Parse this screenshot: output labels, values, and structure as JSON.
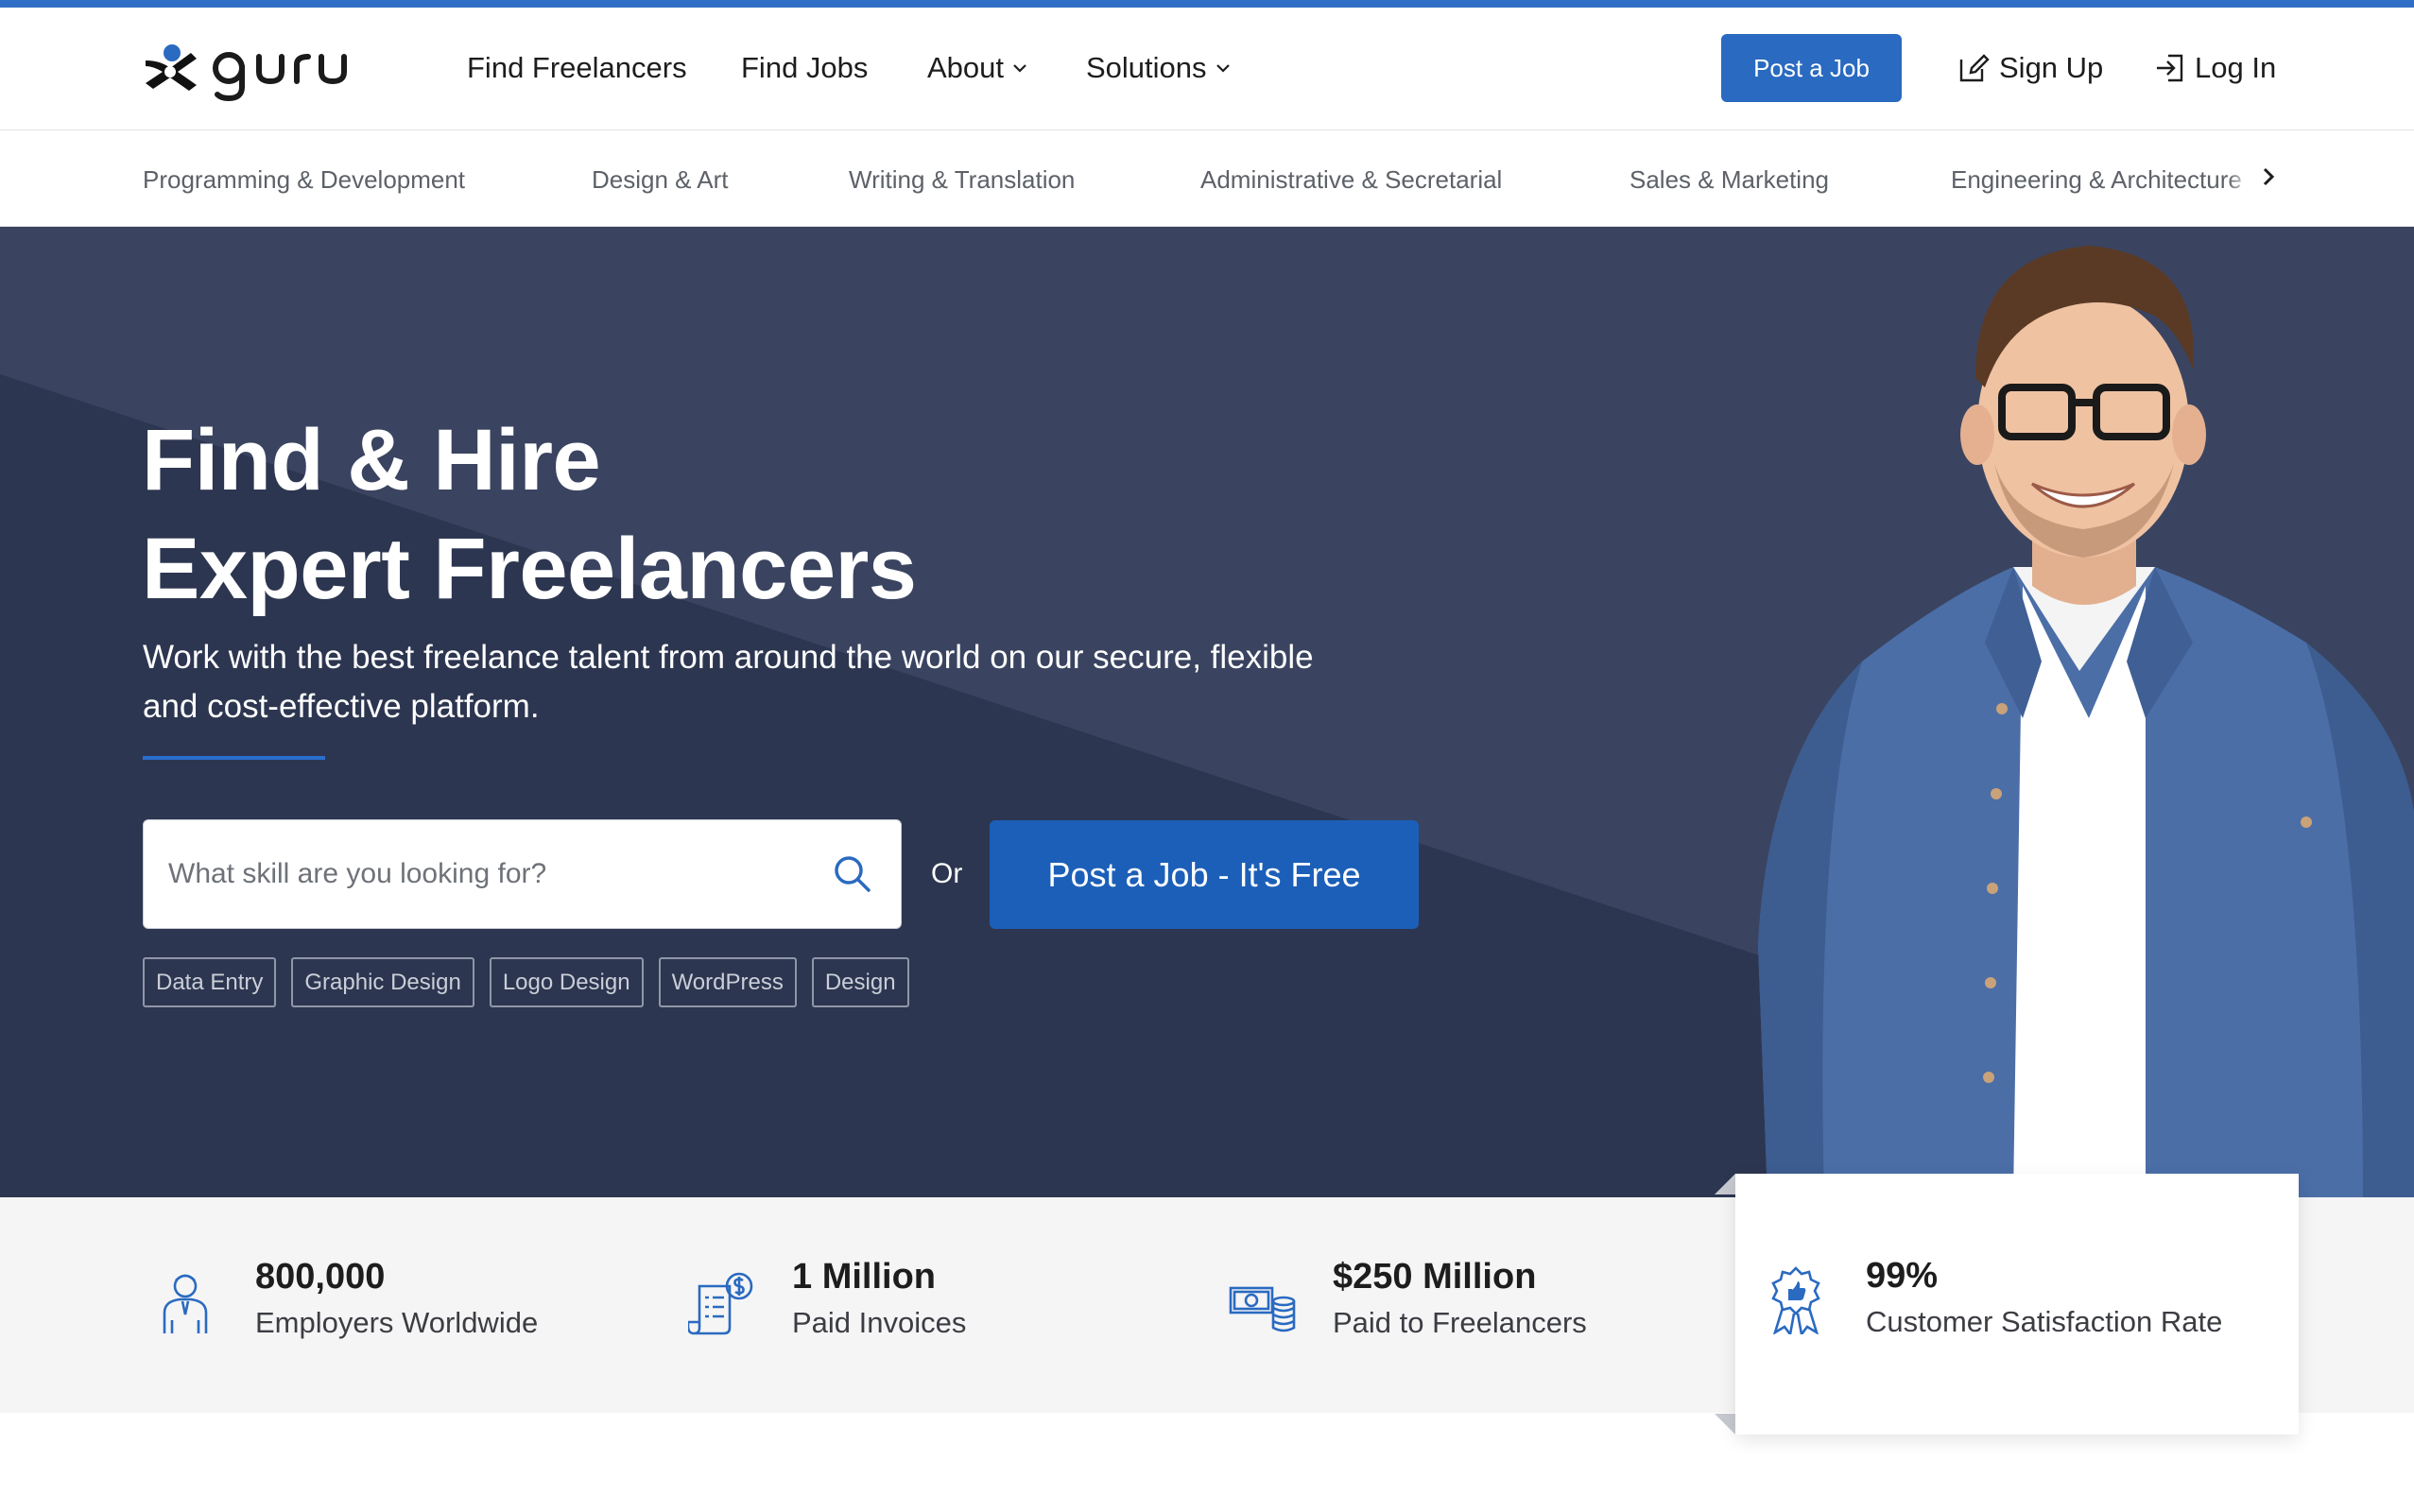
{
  "brand": {
    "name": "guru"
  },
  "header": {
    "nav": [
      {
        "label": "Find Freelancers"
      },
      {
        "label": "Find Jobs"
      },
      {
        "label": "About"
      },
      {
        "label": "Solutions"
      }
    ],
    "post_job_label": "Post a Job",
    "sign_up_label": "Sign Up",
    "log_in_label": "Log In"
  },
  "categories": [
    "Programming & Development",
    "Design & Art",
    "Writing & Translation",
    "Administrative & Secretarial",
    "Sales & Marketing",
    "Engineering & Architecture"
  ],
  "hero": {
    "title_line1": "Find & Hire",
    "title_line2": "Expert Freelancers",
    "subtitle": "Work with the best freelance talent from around the world on our secure, flexible and cost-effective platform.",
    "search_placeholder": "What skill are you looking for?",
    "or_label": "Or",
    "post_job_label": "Post a Job - It's Free",
    "popular_tags": [
      "Data Entry",
      "Graphic Design",
      "Logo Design",
      "WordPress",
      "Design"
    ]
  },
  "stats": [
    {
      "value": "800,000",
      "label": "Employers Worldwide",
      "icon": "employer-icon"
    },
    {
      "value": "1 Million",
      "label": "Paid Invoices",
      "icon": "invoice-icon"
    },
    {
      "value": "$250 Million",
      "label": "Paid to Freelancers",
      "icon": "money-icon"
    },
    {
      "value": "99%",
      "label": "Customer Satisfaction Rate",
      "icon": "award-ribbon-icon"
    }
  ],
  "colors": {
    "accent_blue": "#2a6ac0",
    "hero_dark": "#2d3650",
    "hero_light": "#3a4460"
  }
}
